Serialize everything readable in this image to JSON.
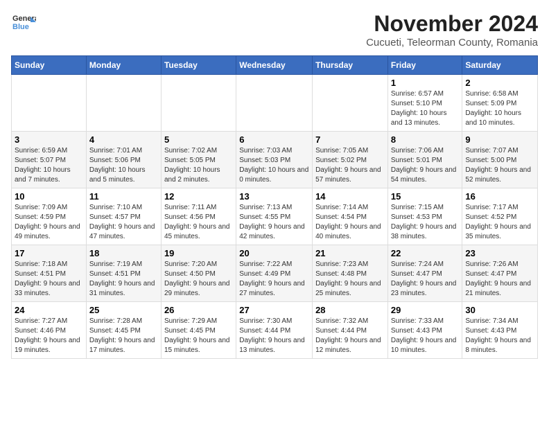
{
  "header": {
    "logo_line1": "General",
    "logo_line2": "Blue",
    "month_year": "November 2024",
    "location": "Cucueti, Teleorman County, Romania"
  },
  "days_of_week": [
    "Sunday",
    "Monday",
    "Tuesday",
    "Wednesday",
    "Thursday",
    "Friday",
    "Saturday"
  ],
  "weeks": [
    [
      {
        "day": "",
        "info": ""
      },
      {
        "day": "",
        "info": ""
      },
      {
        "day": "",
        "info": ""
      },
      {
        "day": "",
        "info": ""
      },
      {
        "day": "",
        "info": ""
      },
      {
        "day": "1",
        "info": "Sunrise: 6:57 AM\nSunset: 5:10 PM\nDaylight: 10 hours and 13 minutes."
      },
      {
        "day": "2",
        "info": "Sunrise: 6:58 AM\nSunset: 5:09 PM\nDaylight: 10 hours and 10 minutes."
      }
    ],
    [
      {
        "day": "3",
        "info": "Sunrise: 6:59 AM\nSunset: 5:07 PM\nDaylight: 10 hours and 7 minutes."
      },
      {
        "day": "4",
        "info": "Sunrise: 7:01 AM\nSunset: 5:06 PM\nDaylight: 10 hours and 5 minutes."
      },
      {
        "day": "5",
        "info": "Sunrise: 7:02 AM\nSunset: 5:05 PM\nDaylight: 10 hours and 2 minutes."
      },
      {
        "day": "6",
        "info": "Sunrise: 7:03 AM\nSunset: 5:03 PM\nDaylight: 10 hours and 0 minutes."
      },
      {
        "day": "7",
        "info": "Sunrise: 7:05 AM\nSunset: 5:02 PM\nDaylight: 9 hours and 57 minutes."
      },
      {
        "day": "8",
        "info": "Sunrise: 7:06 AM\nSunset: 5:01 PM\nDaylight: 9 hours and 54 minutes."
      },
      {
        "day": "9",
        "info": "Sunrise: 7:07 AM\nSunset: 5:00 PM\nDaylight: 9 hours and 52 minutes."
      }
    ],
    [
      {
        "day": "10",
        "info": "Sunrise: 7:09 AM\nSunset: 4:59 PM\nDaylight: 9 hours and 49 minutes."
      },
      {
        "day": "11",
        "info": "Sunrise: 7:10 AM\nSunset: 4:57 PM\nDaylight: 9 hours and 47 minutes."
      },
      {
        "day": "12",
        "info": "Sunrise: 7:11 AM\nSunset: 4:56 PM\nDaylight: 9 hours and 45 minutes."
      },
      {
        "day": "13",
        "info": "Sunrise: 7:13 AM\nSunset: 4:55 PM\nDaylight: 9 hours and 42 minutes."
      },
      {
        "day": "14",
        "info": "Sunrise: 7:14 AM\nSunset: 4:54 PM\nDaylight: 9 hours and 40 minutes."
      },
      {
        "day": "15",
        "info": "Sunrise: 7:15 AM\nSunset: 4:53 PM\nDaylight: 9 hours and 38 minutes."
      },
      {
        "day": "16",
        "info": "Sunrise: 7:17 AM\nSunset: 4:52 PM\nDaylight: 9 hours and 35 minutes."
      }
    ],
    [
      {
        "day": "17",
        "info": "Sunrise: 7:18 AM\nSunset: 4:51 PM\nDaylight: 9 hours and 33 minutes."
      },
      {
        "day": "18",
        "info": "Sunrise: 7:19 AM\nSunset: 4:51 PM\nDaylight: 9 hours and 31 minutes."
      },
      {
        "day": "19",
        "info": "Sunrise: 7:20 AM\nSunset: 4:50 PM\nDaylight: 9 hours and 29 minutes."
      },
      {
        "day": "20",
        "info": "Sunrise: 7:22 AM\nSunset: 4:49 PM\nDaylight: 9 hours and 27 minutes."
      },
      {
        "day": "21",
        "info": "Sunrise: 7:23 AM\nSunset: 4:48 PM\nDaylight: 9 hours and 25 minutes."
      },
      {
        "day": "22",
        "info": "Sunrise: 7:24 AM\nSunset: 4:47 PM\nDaylight: 9 hours and 23 minutes."
      },
      {
        "day": "23",
        "info": "Sunrise: 7:26 AM\nSunset: 4:47 PM\nDaylight: 9 hours and 21 minutes."
      }
    ],
    [
      {
        "day": "24",
        "info": "Sunrise: 7:27 AM\nSunset: 4:46 PM\nDaylight: 9 hours and 19 minutes."
      },
      {
        "day": "25",
        "info": "Sunrise: 7:28 AM\nSunset: 4:45 PM\nDaylight: 9 hours and 17 minutes."
      },
      {
        "day": "26",
        "info": "Sunrise: 7:29 AM\nSunset: 4:45 PM\nDaylight: 9 hours and 15 minutes."
      },
      {
        "day": "27",
        "info": "Sunrise: 7:30 AM\nSunset: 4:44 PM\nDaylight: 9 hours and 13 minutes."
      },
      {
        "day": "28",
        "info": "Sunrise: 7:32 AM\nSunset: 4:44 PM\nDaylight: 9 hours and 12 minutes."
      },
      {
        "day": "29",
        "info": "Sunrise: 7:33 AM\nSunset: 4:43 PM\nDaylight: 9 hours and 10 minutes."
      },
      {
        "day": "30",
        "info": "Sunrise: 7:34 AM\nSunset: 4:43 PM\nDaylight: 9 hours and 8 minutes."
      }
    ]
  ]
}
